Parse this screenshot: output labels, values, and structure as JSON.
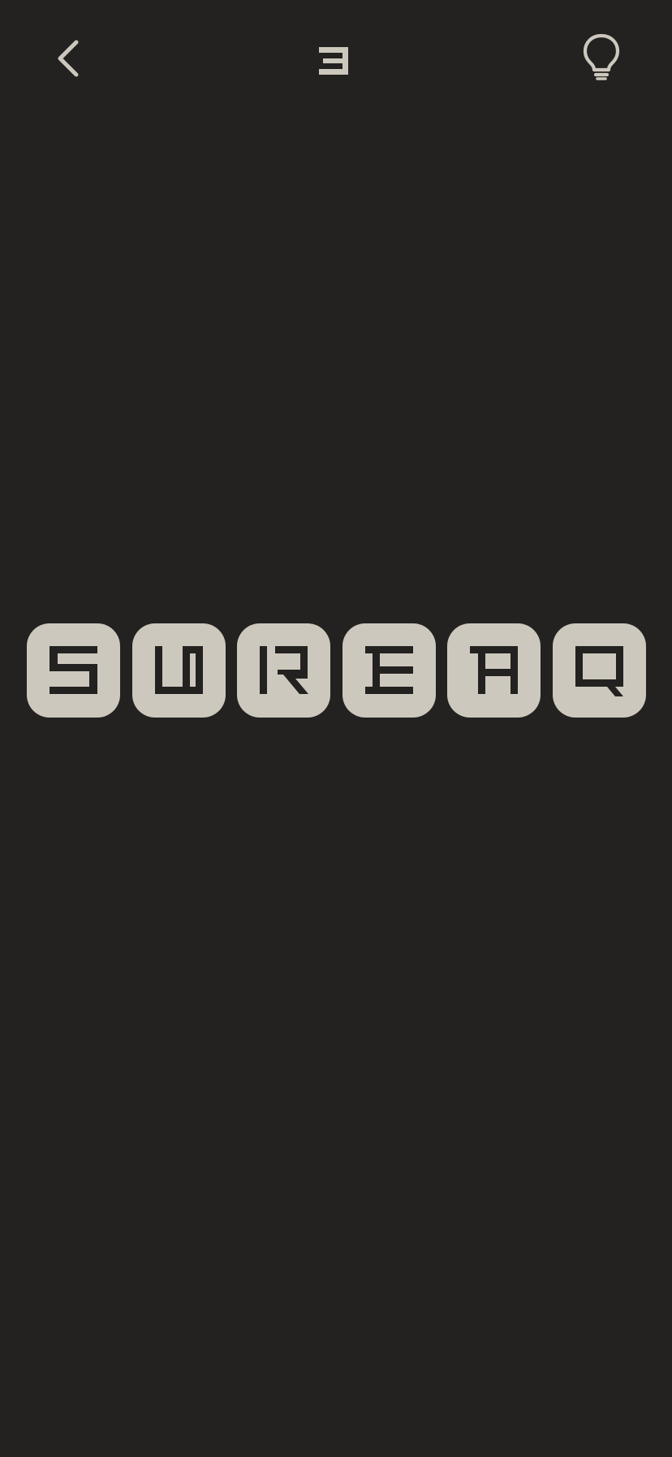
{
  "header": {
    "back_icon": "chevron-left-icon",
    "level_number": "3",
    "hint_icon": "lightbulb-icon"
  },
  "puzzle": {
    "tiles": [
      {
        "letter": "S"
      },
      {
        "letter": "U"
      },
      {
        "letter": "R"
      },
      {
        "letter": "E"
      },
      {
        "letter": "A"
      },
      {
        "letter": "Q"
      }
    ]
  },
  "colors": {
    "background": "#232221",
    "tile": "#cdc8bd",
    "glyph": "#232221",
    "icon": "#cdc8bd"
  }
}
